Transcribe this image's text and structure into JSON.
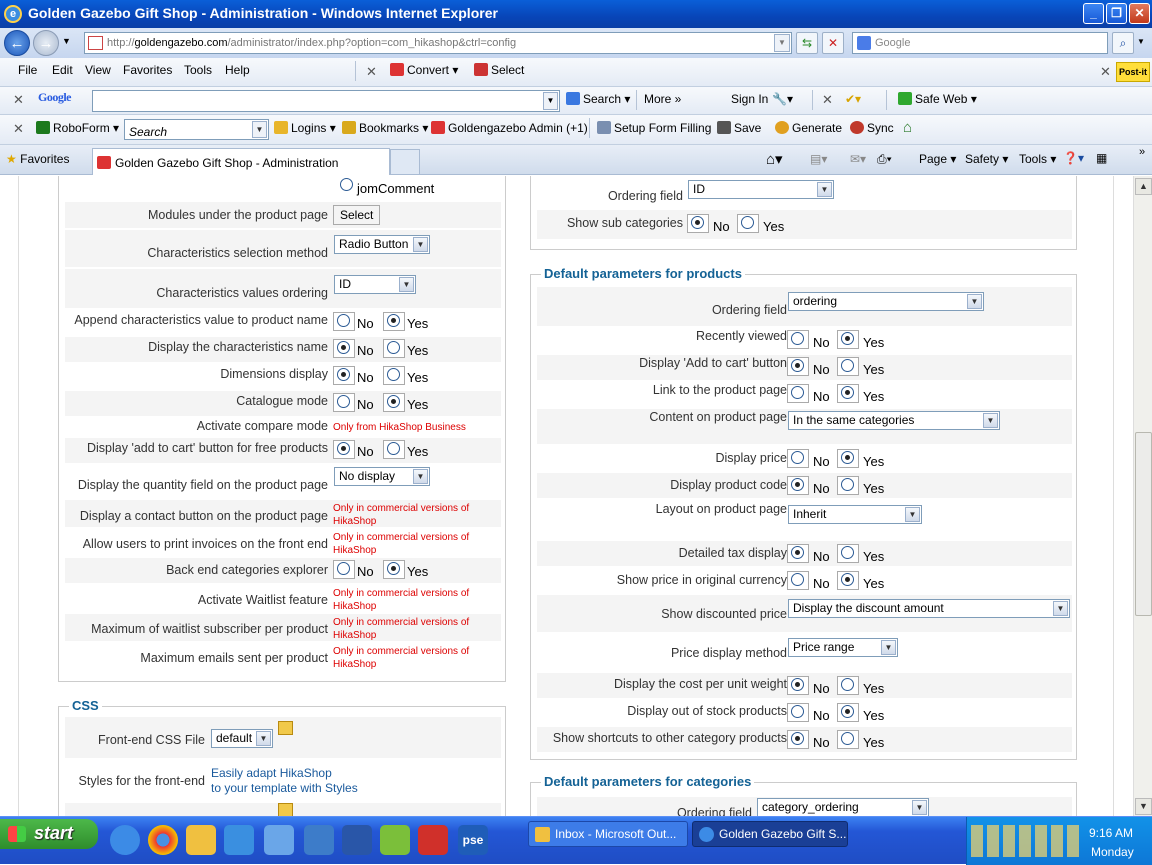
{
  "window": {
    "title": "Golden Gazebo Gift Shop - Administration - Windows Internet Explorer"
  },
  "address": {
    "url_prefix": "http://",
    "url_domain": "goldengazebo.com",
    "url_path": "/administrator/index.php?option=com_hikashop&ctrl=config",
    "search_placeholder": "Google"
  },
  "menu": [
    "File",
    "Edit",
    "View",
    "Favorites",
    "Tools",
    "Help"
  ],
  "convert": "Convert",
  "select_tool": "Select",
  "google_bar": {
    "logo": "Google",
    "search": "Search",
    "more": "More",
    "signin": "Sign In",
    "safeweb": "Safe Web"
  },
  "roboform": {
    "label": "RoboForm",
    "search_placeholder": "Search",
    "logins": "Logins",
    "bookmarks": "Bookmarks",
    "admin": "Goldengazebo Admin (+1)",
    "setup": "Setup Form Filling",
    "save": "Save",
    "generate": "Generate",
    "sync": "Sync"
  },
  "tabs": {
    "favorites": "Favorites",
    "current": "Golden Gazebo Gift Shop - Administration"
  },
  "cmd": {
    "page": "Page",
    "safety": "Safety",
    "tools": "Tools"
  },
  "left": {
    "jomcomment": "jomComment",
    "modules_label": "Modules under the product page",
    "modules_btn": "Select",
    "char_sel_label": "Characteristics selection method",
    "char_sel_val": "Radio Button",
    "char_ord_label": "Characteristics values ordering",
    "char_ord_val": "ID",
    "append_label": "Append characteristics value to product name",
    "disp_char_label": "Display the characteristics name",
    "dimensions_label": "Dimensions display",
    "catalogue_label": "Catalogue mode",
    "compare_label": "Activate compare mode",
    "compare_note": "Only from HikaShop Business",
    "free_cart_label": "Display 'add to cart' button for free products",
    "qty_label": "Display the quantity field on the product page",
    "qty_val": "No display",
    "contact_label": "Display a contact button on the product page",
    "print_label": "Allow users to print invoices on the front end",
    "backend_label": "Back end categories explorer",
    "waitlist_label": "Activate Waitlist feature",
    "max_wait_label": "Maximum of waitlist subscriber per product",
    "max_email_label": "Maximum emails sent per product",
    "commercial_note_1": "Only in commercial versions of",
    "commercial_note_2": "HikaShop",
    "no": "No",
    "yes": "Yes"
  },
  "css": {
    "legend": "CSS",
    "frontend_label": "Front-end CSS File",
    "frontend_val": "default",
    "styles_label": "Styles for the front-end",
    "styles_link_1": "Easily adapt HikaShop",
    "styles_link_2": "to your template with Styles"
  },
  "right_top": {
    "ordering_label": "Ordering field",
    "ordering_val": "ID",
    "sub_label": "Show sub categories"
  },
  "products": {
    "legend": "Default parameters for products",
    "ordering_label": "Ordering field",
    "ordering_val": "ordering",
    "recent_label": "Recently viewed",
    "addcart_label": "Display 'Add to cart' button",
    "link_label": "Link to the product page",
    "content_label": "Content on product page",
    "content_val": "In the same categories",
    "price_label": "Display price",
    "code_label": "Display product code",
    "layout_label": "Layout on product page",
    "layout_val": "Inherit",
    "tax_label": "Detailed tax display",
    "orig_curr_label": "Show price in original currency",
    "discount_label": "Show discounted price",
    "discount_val": "Display the discount amount",
    "method_label": "Price display method",
    "method_val": "Price range",
    "unit_label": "Display the cost per unit weight",
    "stock_label": "Display out of stock products",
    "shortcuts_label": "Show shortcuts to other category products"
  },
  "categories": {
    "legend": "Default parameters for categories",
    "ordering_label": "Ordering field",
    "ordering_val": "category_ordering"
  },
  "taskbar": {
    "start": "start",
    "inbox": "Inbox - Microsoft Out...",
    "ie": "Golden Gazebo Gift S...",
    "time": "9:16 AM",
    "day": "Monday"
  }
}
